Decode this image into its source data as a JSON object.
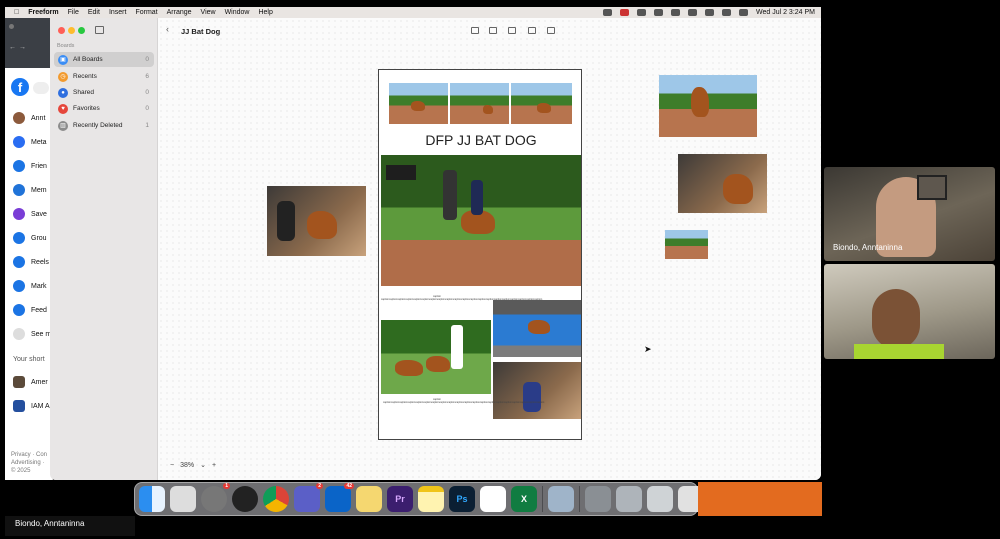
{
  "menubar": {
    "app": "Freeform",
    "items": [
      "File",
      "Edit",
      "Insert",
      "Format",
      "Arrange",
      "View",
      "Window",
      "Help"
    ],
    "clock": "Wed Jul 2  3:24 PM"
  },
  "browser": {
    "items": [
      "Annt",
      "Meta",
      "Frien",
      "Mem",
      "Save",
      "Grou",
      "Reels",
      "Mark",
      "Feed",
      "See m"
    ],
    "shortcuts_title": "Your short",
    "shortcut_items": [
      "Amer",
      "IAM A"
    ],
    "footer": [
      "Privacy · Con",
      "Advertising ·",
      "© 2025"
    ]
  },
  "sidebar": {
    "section": "Boards",
    "items": [
      {
        "label": "All Boards",
        "count": "0",
        "color": "#3a8df5"
      },
      {
        "label": "Recents",
        "count": "6",
        "color": "#f29a2e"
      },
      {
        "label": "Shared",
        "count": "0",
        "color": "#2f6fdf"
      },
      {
        "label": "Favorites",
        "count": "0",
        "color": "#e5463b"
      },
      {
        "label": "Recently Deleted",
        "count": "1",
        "color": "#8c8c8c"
      }
    ]
  },
  "board": {
    "title": "JJ Bat Dog",
    "doc_title": "DFP  JJ BAT DOG",
    "caption_label": "caption",
    "caption_text": "captioncaptioncaptioncaptioncaptioncaptioncaptioncaptioncaptioncaptioncaptioncaptioncaptioncaptioncaptioncaptioncaptioncaptioncaptioncaption",
    "zoom": "38%",
    "zoom_minus": "−",
    "zoom_plus": "+"
  },
  "participants": [
    {
      "name": "Biondo, Anntaninna"
    },
    {
      "name": ""
    }
  ],
  "bottom_name": "Biondo, Anntaninna",
  "dock": {
    "apps": [
      "Finder",
      "Launchpad",
      "System Settings",
      "Photo Booth",
      "Chrome",
      "Teams",
      "Outlook",
      "Notes",
      "Premiere Pro",
      "Notes Pad",
      "Photoshop",
      "Freeform",
      "Excel",
      "Preview"
    ],
    "badges": {
      "System Settings": "1",
      "Teams": "2",
      "Outlook": "42"
    }
  }
}
